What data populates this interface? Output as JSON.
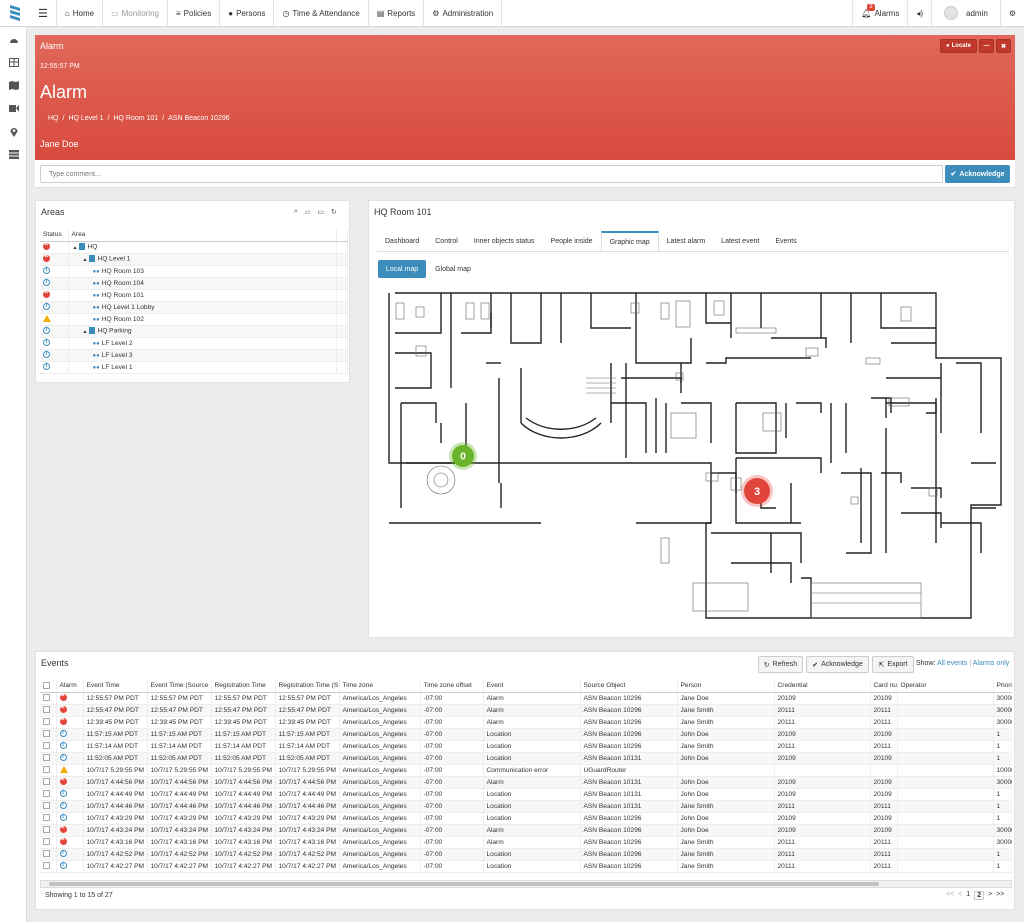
{
  "nav": {
    "items": [
      "Home",
      "Monitoring",
      "Policies",
      "Persons",
      "Time & Attendance",
      "Reports",
      "Administration"
    ],
    "alarms_label": "Alarms",
    "alarms_count": "3",
    "user": "admin"
  },
  "alarm_banner": {
    "header": "Alarm",
    "time": "12:55:57 PM",
    "title": "Alarm",
    "breadcrumb": [
      "HQ",
      "HQ Level 1",
      "HQ Room 101",
      "ASN Beacon 10296"
    ],
    "person": "Jane Doe",
    "locate_label": "Locate"
  },
  "comment": {
    "placeholder": "Type comment...",
    "ack_label": "Acknowledge"
  },
  "areas": {
    "title": "Areas",
    "columns": [
      "Status",
      "Area"
    ],
    "rows": [
      {
        "status": "error",
        "name": "HQ",
        "depth": 0,
        "type": "building"
      },
      {
        "status": "error",
        "name": "HQ Level 1",
        "depth": 1,
        "type": "building"
      },
      {
        "status": "info",
        "name": "HQ Room 103",
        "depth": 2,
        "type": "room"
      },
      {
        "status": "info",
        "name": "HQ Room 104",
        "depth": 2,
        "type": "room"
      },
      {
        "status": "error",
        "name": "HQ Room 101",
        "depth": 2,
        "type": "room"
      },
      {
        "status": "info",
        "name": "HQ Level 1 Lobby",
        "depth": 2,
        "type": "room"
      },
      {
        "status": "warning",
        "name": "HQ Room 102",
        "depth": 2,
        "type": "room"
      },
      {
        "status": "info",
        "name": "HQ Parking",
        "depth": 1,
        "type": "building"
      },
      {
        "status": "info",
        "name": "LF Level 2",
        "depth": 2,
        "type": "room"
      },
      {
        "status": "info",
        "name": "LF Level 3",
        "depth": 2,
        "type": "room"
      },
      {
        "status": "info",
        "name": "LF Level 1",
        "depth": 2,
        "type": "room"
      }
    ]
  },
  "room": {
    "title": "HQ Room 101",
    "tabs": [
      "Dashboard",
      "Control",
      "Inner objects status",
      "People inside",
      "Graphic map",
      "Latest alarm",
      "Latest event",
      "Events"
    ],
    "active_tab": "Graphic map",
    "subtabs": [
      "Local map",
      "Global map"
    ],
    "markers": {
      "green": "0",
      "red": "3"
    }
  },
  "events": {
    "title": "Events",
    "refresh_label": "Refresh",
    "ack_label": "Acknowledge",
    "export_label": "Export",
    "show_label": "Show:",
    "all_events": "All events",
    "alarms_only": "Alarms only",
    "columns": [
      "Alarm",
      "Event Time",
      "Event Time (Source",
      "Registration Time",
      "Registration Time (S",
      "Time zone",
      "Time zone offset",
      "Event",
      "Source Object",
      "Person",
      "Credential",
      "Card nu",
      "Operator",
      "Priori"
    ],
    "rows": [
      {
        "s": "error",
        "et": "12:55:57 PM PDT",
        "ets": "12:55:57 PM PDT",
        "rt": "12:55:57 PM PDT",
        "rts": "12:55:57 PM PDT",
        "tz": "America/Los_Angeles",
        "tzo": "-07:00",
        "ev": "Alarm",
        "src": "ASN Beacon 10296",
        "p": "Jane Doe",
        "c": "20109",
        "card": "20109",
        "op": "",
        "pr": "30000"
      },
      {
        "s": "error",
        "et": "12:55:47 PM PDT",
        "ets": "12:55:47 PM PDT",
        "rt": "12:55:47 PM PDT",
        "rts": "12:55:47 PM PDT",
        "tz": "America/Los_Angeles",
        "tzo": "-07:00",
        "ev": "Alarm",
        "src": "ASN Beacon 10296",
        "p": "Jane Smith",
        "c": "20111",
        "card": "20111",
        "op": "",
        "pr": "30000"
      },
      {
        "s": "error",
        "et": "12:39:45 PM PDT",
        "ets": "12:39:45 PM PDT",
        "rt": "12:39:45 PM PDT",
        "rts": "12:39:45 PM PDT",
        "tz": "America/Los_Angeles",
        "tzo": "-07:00",
        "ev": "Alarm",
        "src": "ASN Beacon 10296",
        "p": "Jane Smith",
        "c": "20111",
        "card": "20111",
        "op": "",
        "pr": "30000"
      },
      {
        "s": "info",
        "et": "11:57:15 AM PDT",
        "ets": "11:57:15 AM PDT",
        "rt": "11:57:15 AM PDT",
        "rts": "11:57:15 AM PDT",
        "tz": "America/Los_Angeles",
        "tzo": "-07:00",
        "ev": "Location",
        "src": "ASN Beacon 10296",
        "p": "John Doe",
        "c": "20109",
        "card": "20109",
        "op": "",
        "pr": "1"
      },
      {
        "s": "info",
        "et": "11:57:14 AM PDT",
        "ets": "11:57:14 AM PDT",
        "rt": "11:57:14 AM PDT",
        "rts": "11:57:14 AM PDT",
        "tz": "America/Los_Angeles",
        "tzo": "-07:00",
        "ev": "Location",
        "src": "ASN Beacon 10296",
        "p": "Jane Smith",
        "c": "20111",
        "card": "20111",
        "op": "",
        "pr": "1"
      },
      {
        "s": "info",
        "et": "11:52:05 AM PDT",
        "ets": "11:52:05 AM PDT",
        "rt": "11:52:05 AM PDT",
        "rts": "11:52:05 AM PDT",
        "tz": "America/Los_Angeles",
        "tzo": "-07:00",
        "ev": "Location",
        "src": "ASN Beacon 10131",
        "p": "John Doe",
        "c": "20109",
        "card": "20109",
        "op": "",
        "pr": "1"
      },
      {
        "s": "warning",
        "et": "10/7/17 5:29:55 PM",
        "ets": "10/7/17 5:29:55 PM",
        "rt": "10/7/17 5:29:55 PM",
        "rts": "10/7/17 5:29:55 PM",
        "tz": "America/Los_Angeles",
        "tzo": "-07:00",
        "ev": "Communication error",
        "src": "UGuardRouter",
        "p": "",
        "c": "",
        "card": "",
        "op": "",
        "pr": "10000"
      },
      {
        "s": "error",
        "et": "10/7/17 4:44:56 PM",
        "ets": "10/7/17 4:44:56 PM",
        "rt": "10/7/17 4:44:56 PM",
        "rts": "10/7/17 4:44:56 PM",
        "tz": "America/Los_Angeles",
        "tzo": "-07:00",
        "ev": "Alarm",
        "src": "ASN Beacon 10131",
        "p": "John Doe",
        "c": "20109",
        "card": "20109",
        "op": "",
        "pr": "30000"
      },
      {
        "s": "info",
        "et": "10/7/17 4:44:49 PM",
        "ets": "10/7/17 4:44:49 PM",
        "rt": "10/7/17 4:44:49 PM",
        "rts": "10/7/17 4:44:49 PM",
        "tz": "America/Los_Angeles",
        "tzo": "-07:00",
        "ev": "Location",
        "src": "ASN Beacon 10131",
        "p": "John Doe",
        "c": "20109",
        "card": "20109",
        "op": "",
        "pr": "1"
      },
      {
        "s": "info",
        "et": "10/7/17 4:44:46 PM",
        "ets": "10/7/17 4:44:46 PM",
        "rt": "10/7/17 4:44:46 PM",
        "rts": "10/7/17 4:44:46 PM",
        "tz": "America/Los_Angeles",
        "tzo": "-07:00",
        "ev": "Location",
        "src": "ASN Beacon 10131",
        "p": "Jane Smith",
        "c": "20111",
        "card": "20111",
        "op": "",
        "pr": "1"
      },
      {
        "s": "info",
        "et": "10/7/17 4:43:29 PM",
        "ets": "10/7/17 4:43:29 PM",
        "rt": "10/7/17 4:43:29 PM",
        "rts": "10/7/17 4:43:29 PM",
        "tz": "America/Los_Angeles",
        "tzo": "-07:00",
        "ev": "Location",
        "src": "ASN Beacon 10296",
        "p": "John Doe",
        "c": "20109",
        "card": "20109",
        "op": "",
        "pr": "1"
      },
      {
        "s": "error",
        "et": "10/7/17 4:43:24 PM",
        "ets": "10/7/17 4:43:24 PM",
        "rt": "10/7/17 4:43:24 PM",
        "rts": "10/7/17 4:43:24 PM",
        "tz": "America/Los_Angeles",
        "tzo": "-07:00",
        "ev": "Alarm",
        "src": "ASN Beacon 10296",
        "p": "John Doe",
        "c": "20109",
        "card": "20109",
        "op": "",
        "pr": "30000"
      },
      {
        "s": "error",
        "et": "10/7/17 4:43:16 PM",
        "ets": "10/7/17 4:43:16 PM",
        "rt": "10/7/17 4:43:16 PM",
        "rts": "10/7/17 4:43:16 PM",
        "tz": "America/Los_Angeles",
        "tzo": "-07:00",
        "ev": "Alarm",
        "src": "ASN Beacon 10296",
        "p": "Jane Smith",
        "c": "20111",
        "card": "20111",
        "op": "",
        "pr": "30000"
      },
      {
        "s": "info",
        "et": "10/7/17 4:42:52 PM",
        "ets": "10/7/17 4:42:52 PM",
        "rt": "10/7/17 4:42:52 PM",
        "rts": "10/7/17 4:42:52 PM",
        "tz": "America/Los_Angeles",
        "tzo": "-07:00",
        "ev": "Location",
        "src": "ASN Beacon 10296",
        "p": "Jane Smith",
        "c": "20111",
        "card": "20111",
        "op": "",
        "pr": "1"
      },
      {
        "s": "info",
        "et": "10/7/17 4:42:27 PM",
        "ets": "10/7/17 4:42:27 PM",
        "rt": "10/7/17 4:42:27 PM",
        "rts": "10/7/17 4:42:27 PM",
        "tz": "America/Los_Angeles",
        "tzo": "-07:00",
        "ev": "Location",
        "src": "ASN Beacon 10296",
        "p": "Jane Smith",
        "c": "20111",
        "card": "20111",
        "op": "",
        "pr": "1"
      }
    ],
    "footer": "Showing 1 to 15 of 27",
    "pager": [
      "<<",
      "<",
      "1",
      "2",
      ">",
      ">>"
    ],
    "current_page": "2"
  },
  "colors": {
    "alarm_red": "#d84a3d",
    "accent_blue": "#3c8dbc",
    "marker_green": "#6ab42d",
    "marker_red": "#e0443b"
  }
}
